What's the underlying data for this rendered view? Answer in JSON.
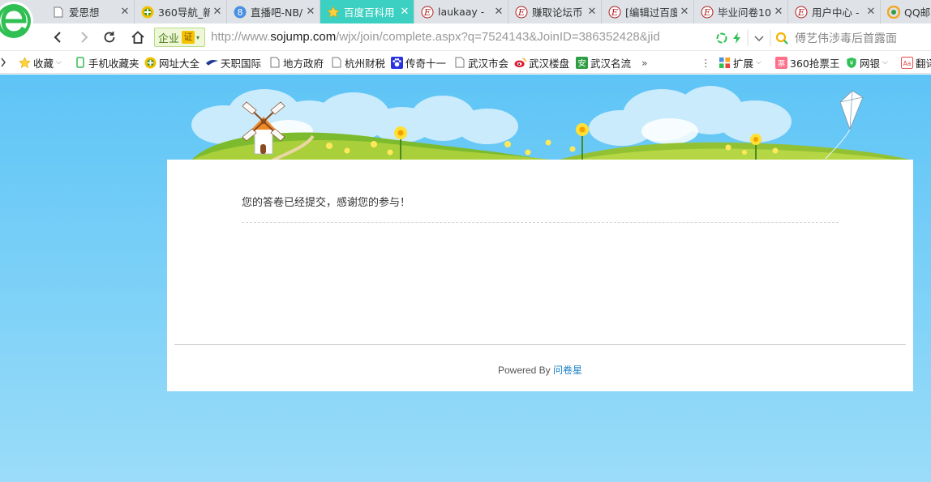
{
  "tabs": [
    {
      "title": "爱思想",
      "icon": "page-icon"
    },
    {
      "title": "360导航_新",
      "icon": "360-nav-icon"
    },
    {
      "title": "直播吧-NB/",
      "icon": "zhibo8-icon"
    },
    {
      "title": "百度百科用",
      "icon": "star-icon",
      "active": true
    },
    {
      "title": "laukaay - ",
      "icon": "e-icon"
    },
    {
      "title": "赚取论坛币",
      "icon": "e-icon"
    },
    {
      "title": "[编辑过百度",
      "icon": "e-icon"
    },
    {
      "title": "毕业问卷10",
      "icon": "e-icon"
    },
    {
      "title": "用户中心 -",
      "icon": "e-icon"
    },
    {
      "title": "QQ邮",
      "icon": "qq-mail-icon"
    }
  ],
  "address_bar": {
    "cert_label": "企业",
    "cert_badge": "证",
    "url_prefix": "http://www.",
    "url_host": "sojump.com",
    "url_path": "/wjx/join/complete.aspx?q=7524143&JoinID=386352428&jid",
    "search_text": "傅艺伟涉毒后首露面"
  },
  "bookmarks": [
    {
      "label": "收藏",
      "icon": "star-icon",
      "dropdown": true
    },
    {
      "label": "手机收藏夹",
      "icon": "phone-icon"
    },
    {
      "label": "网址大全",
      "icon": "360-nav-icon"
    },
    {
      "label": "天职国际",
      "icon": "bird-icon"
    },
    {
      "label": "地方政府",
      "icon": "page-icon"
    },
    {
      "label": "杭州财税",
      "icon": "page-icon"
    },
    {
      "label": "传奇十一",
      "icon": "paw-icon"
    },
    {
      "label": "武汉市会",
      "icon": "page-icon"
    },
    {
      "label": "武汉楼盘",
      "icon": "weibo-icon"
    },
    {
      "label": "武汉名流",
      "icon": "an-icon"
    }
  ],
  "bookmarks_right": [
    {
      "label": "扩展",
      "icon": "extension-icon",
      "dropdown": true
    },
    {
      "label": "360抢票王",
      "icon": "ticket-icon"
    },
    {
      "label": "网银",
      "icon": "shield-icon",
      "dropdown": true
    },
    {
      "label": "翻译",
      "icon": "translate-icon"
    }
  ],
  "content": {
    "message": "您的答卷已经提交，感谢您的参与！",
    "powered_by": "Powered By",
    "brand_link": "问卷星"
  },
  "colors": {
    "active_tab": "#3bd0c1",
    "sky": "#5ec4f6",
    "link": "#1a7fc9"
  }
}
